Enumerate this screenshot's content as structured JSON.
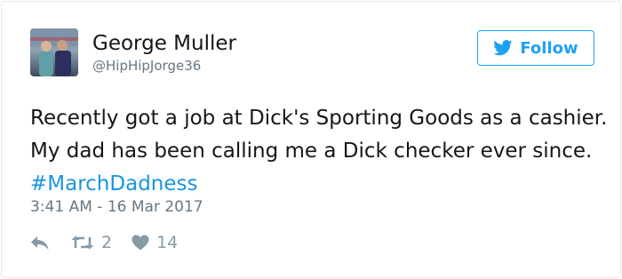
{
  "tweet": {
    "author_name": "George Muller",
    "author_handle": "@HipHipJorge36",
    "follow_label": "Follow",
    "text_before": "Recently got a job at Dick's Sporting Goods as a cashier. My dad has been calling me a Dick checker ever since. ",
    "hashtag": "#MarchDadness",
    "timestamp": "3:41 AM - 16 Mar 2017",
    "retweet_count": "2",
    "like_count": "14"
  },
  "icons": {
    "reply": "reply-icon",
    "retweet": "retweet-icon",
    "like": "heart-icon",
    "follow": "twitter-bird-icon"
  },
  "colors": {
    "accent": "#1da1f2",
    "hashtag": "#1b95e0",
    "muted": "#657786",
    "action_icons": "#8899a6"
  }
}
